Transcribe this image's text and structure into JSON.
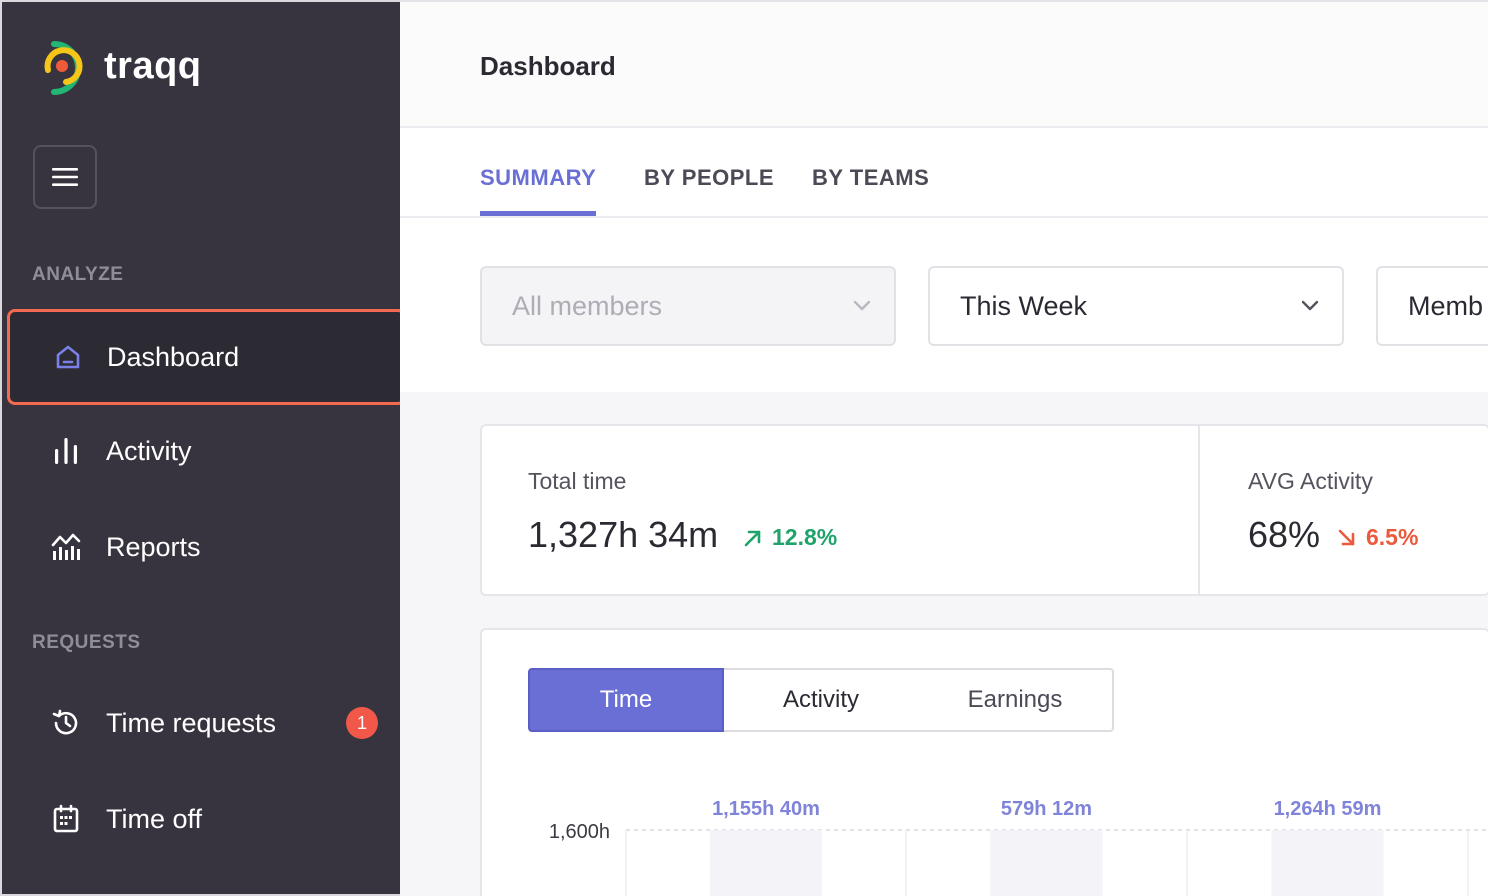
{
  "app": {
    "name": "traqq",
    "colors": {
      "sidebar": "#37343f",
      "accent": "#6a6fd6",
      "up": "#20a36b",
      "down": "#eb5a3c",
      "badge": "#f2584a",
      "highlight": "#f26a4f"
    }
  },
  "sidebar": {
    "menu_icon": "hamburger-icon",
    "sections": [
      {
        "label": "ANALYZE"
      },
      {
        "label": "REQUESTS"
      }
    ],
    "items": [
      {
        "label": "Dashboard",
        "icon": "home-icon",
        "active": true
      },
      {
        "label": "Activity",
        "icon": "bar-chart-icon"
      },
      {
        "label": "Reports",
        "icon": "reports-chart-icon"
      },
      {
        "label": "Time requests",
        "icon": "history-icon",
        "badge": "1"
      },
      {
        "label": "Time off",
        "icon": "calendar-icon"
      }
    ]
  },
  "header": {
    "title": "Dashboard"
  },
  "tabs": [
    {
      "label": "SUMMARY",
      "active": true
    },
    {
      "label": "BY PEOPLE"
    },
    {
      "label": "BY TEAMS"
    }
  ],
  "filters": {
    "members": {
      "value": "All members",
      "disabled": true
    },
    "period": {
      "value": "This Week"
    },
    "third": {
      "value": "Memb"
    }
  },
  "stats": {
    "total_time": {
      "label": "Total time",
      "value": "1,327h 34m",
      "change": "12.8%",
      "direction": "up"
    },
    "avg_activity": {
      "label": "AVG Activity",
      "value": "68%",
      "change": "6.5%",
      "direction": "down"
    }
  },
  "chart_toggle": {
    "options": [
      "Time",
      "Activity",
      "Earnings"
    ],
    "selected": "Time"
  },
  "chart_data": {
    "type": "bar",
    "y_tick_labels": [
      "1,600h"
    ],
    "data_labels": [
      "1,155h 40m",
      "579h 12m",
      "1,264h 59m"
    ],
    "values_hours": [
      1155.67,
      579.2,
      1264.98
    ]
  }
}
